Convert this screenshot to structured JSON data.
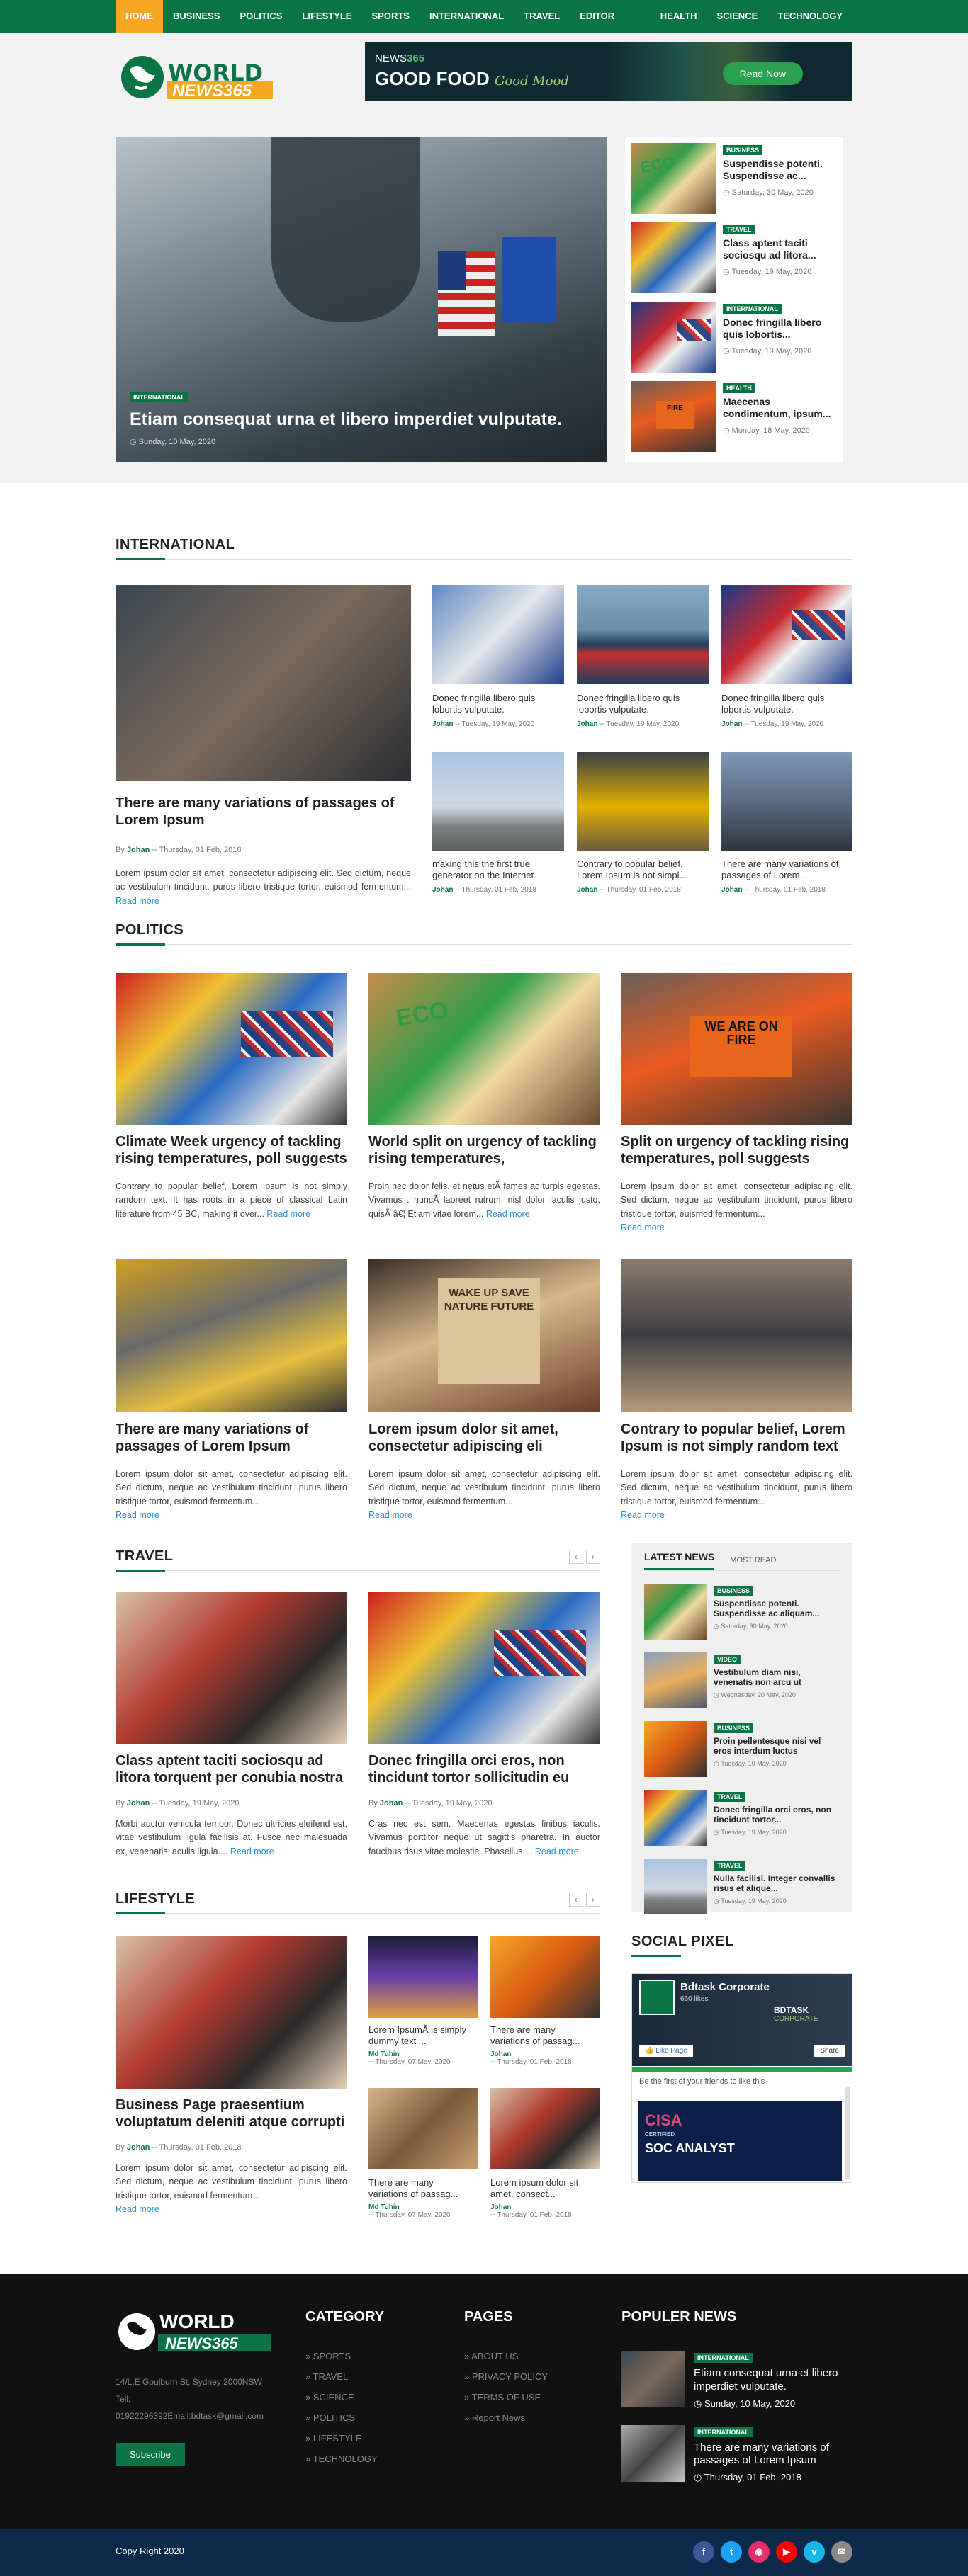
{
  "nav": [
    "HOME",
    "BUSINESS",
    "POLITICS",
    "LIFESTYLE",
    "SPORTS",
    "INTERNATIONAL",
    "TRAVEL",
    "EDITOR CHOICE",
    "HEALTH",
    "SCIENCE",
    "TECHNOLOGY"
  ],
  "logo": {
    "line1": "WORLD",
    "line2": "NEWS365"
  },
  "ad": {
    "brand_a": "NEWS",
    "brand_b": "365",
    "title": "GOOD FOOD",
    "script": "Good Mood",
    "button": "Read Now"
  },
  "hero": {
    "tag": "INTERNATIONAL",
    "title": "Etiam consequat urna et libero imperdiet vulputate.",
    "date": "Sunday, 10 May, 2020"
  },
  "side": [
    {
      "tag": "BUSINESS",
      "title": "Suspendisse potenti. Suspendisse ac...",
      "date": "Saturday, 30 May, 2020"
    },
    {
      "tag": "TRAVEL",
      "title": "Class aptent taciti sociosqu ad litora...",
      "date": "Tuesday, 19 May, 2020"
    },
    {
      "tag": "INTERNATIONAL",
      "title": "Donec fringilla libero quis lobortis...",
      "date": "Tuesday, 19 May, 2020"
    },
    {
      "tag": "HEALTH",
      "title": "Maecenas condimentum, ipsum...",
      "date": "Monday, 18 May, 2020"
    }
  ],
  "international": {
    "title": "INTERNATIONAL",
    "main": {
      "title": "There are many variations of passages of Lorem Ipsum",
      "by": "By",
      "author": "Johan",
      "date": "-- Thursday, 01 Feb, 2018",
      "excerpt": "Lorem ipsum dolor sit amet, consectetur adipiscing elit. Sed dictum, neque ac vestibulum tincidunt, purus libero tristique tortor, euismod fermentum...",
      "more": "Read more"
    },
    "grid": [
      {
        "title": "Donec fringilla libero quis lobortis vulputate.",
        "author": "Johan",
        "date": "-- Tuesday, 19 May, 2020"
      },
      {
        "title": "Donec fringilla libero quis lobortis vulputate.",
        "author": "Johan",
        "date": "-- Tuesday, 19 May, 2020"
      },
      {
        "title": "Donec fringilla libero quis lobortis vulputate.",
        "author": "Johan",
        "date": "-- Tuesday, 19 May, 2020"
      },
      {
        "title": "making this the first true generator on the Internet.",
        "author": "Johan",
        "date": "-- Thursday, 01 Feb, 2018"
      },
      {
        "title": "Contrary to popular belief, Lorem Ipsum is not simpl...",
        "author": "Johan",
        "date": "-- Thursday, 01 Feb, 2018"
      },
      {
        "title": "There are many variations of passages of Lorem...",
        "author": "Johan",
        "date": "-- Thursday, 01 Feb, 2018"
      }
    ]
  },
  "politics": {
    "title": "POLITICS",
    "items": [
      {
        "title": "Climate Week urgency of tackling rising temperatures, poll suggests",
        "excerpt": "Contrary to popular belief, Lorem Ipsum is not simply random text. It has roots in a piece of classical Latin literature from 45 BC, making it over...",
        "more": "Read more"
      },
      {
        "title": "World split on urgency of tackling rising temperatures,",
        "excerpt": "Proin nec dolor felis. et netus etÃ  fames ac turpis egestas. Vivamus . nuncÃ  laoreet rutrum, nisl dolor iaculis justo, quisÃ â€¦ Etiam vitae lorem...",
        "more": "Read more"
      },
      {
        "title": "Split on urgency of tackling rising temperatures, poll suggests",
        "excerpt": "Lorem ipsum dolor sit amet, consectetur adipiscing elit. Sed dictum, neque ac vestibulum tincidunt, purus libero tristique tortor, euismod fermentum...",
        "more": "Read more"
      },
      {
        "title": "There are many variations of passages of Lorem Ipsum",
        "excerpt": "Lorem ipsum dolor sit amet, consectetur adipiscing elit. Sed dictum, neque ac vestibulum tincidunt, purus libero tristique tortor, euismod fermentum...",
        "more": "Read more"
      },
      {
        "title": "Lorem ipsum dolor sit amet, consectetur adipiscing eli",
        "excerpt": "Lorem ipsum dolor sit amet, consectetur adipiscing elit. Sed dictum, neque ac vestibulum tincidunt, purus libero tristique tortor, euismod fermentum...",
        "more": "Read more"
      },
      {
        "title": "Contrary to popular belief, Lorem Ipsum is not simply random text",
        "excerpt": "Lorem ipsum dolor sit amet, consectetur adipiscing elit. Sed dictum, neque ac vestibulum tincidunt, purus libero tristique tortor, euismod fermentum...",
        "more": "Read more"
      }
    ],
    "signs": {
      "eco": "ECO",
      "fire": "WE ARE ON FIRE",
      "wake": "WAKE UP SAVE NATURE FUTURE"
    }
  },
  "travel": {
    "title": "TRAVEL",
    "items": [
      {
        "title": "Class aptent taciti sociosqu ad litora torquent per conubia nostra",
        "by": "By",
        "author": "Johan",
        "date": "-- Tuesday, 19 May, 2020",
        "excerpt": "Morbi auctor vehicula tempor. Donec ultricies eleifend est, vitae vestibulum ligula facilisis at. Fusce nec malesuada ex, venenatis iaculis ligula....",
        "more": "Read more"
      },
      {
        "title": "Donec fringilla orci eros, non tincidunt tortor sollicitudin eu",
        "by": "By",
        "author": "Johan",
        "date": "-- Tuesday, 19 May, 2020",
        "excerpt": "Cras nec est sem. Maecenas egestas finibus iaculis. Vivamus porttitor neque ut sagittis pharetra. In auctor faucibus risus vitae molestie. Phasellus....",
        "more": "Read more"
      }
    ]
  },
  "lifestyle": {
    "title": "LIFESTYLE",
    "main": {
      "title": "Business Page praesentium voluptatum deleniti atque corrupti",
      "by": "By",
      "author": "Johan",
      "date": "-- Thursday, 01 Feb, 2018",
      "excerpt": "Lorem ipsum dolor sit amet, consectetur adipiscing elit. Sed dictum, neque ac vestibulum tincidunt, purus libero tristique tortor, euismod fermentum...",
      "more": "Read more"
    },
    "grid": [
      {
        "title": "Lorem IpsumÃ is simply dummy text ...",
        "author": "Md Tuhin",
        "date": "-- Thursday, 07 May, 2020"
      },
      {
        "title": "There are many variations of passag...",
        "author": "Johan",
        "date": "-- Thursday, 01 Feb, 2018"
      },
      {
        "title": "There are many variations of passag...",
        "author": "Md Tuhin",
        "date": "-- Thursday, 07 May, 2020"
      },
      {
        "title": "Lorem ipsum dolor sit amet, consect...",
        "author": "Johan",
        "date": "-- Thursday, 01 Feb, 2018"
      }
    ]
  },
  "tabs": {
    "active": "LATEST NEWS",
    "other": "MOST READ",
    "items": [
      {
        "tag": "BUSINESS",
        "title": "Suspendisse potenti. Suspendisse ac aliquam...",
        "date": "Saturday, 30 May, 2020"
      },
      {
        "tag": "VIDEO",
        "title": "Vestibulum diam nisi, venenatis non arcu ut",
        "date": "Wednesday, 20 May, 2020"
      },
      {
        "tag": "BUSINESS",
        "title": "Proin pellentesque nisi vel eros interdum luctus",
        "date": "Tuesday, 19 May, 2020"
      },
      {
        "tag": "TRAVEL",
        "title": "Donec fringilla orci eros, non tincidunt tortor...",
        "date": "Tuesday, 19 May, 2020"
      },
      {
        "tag": "TRAVEL",
        "title": "Nulla facilisi. Integer convallis risus et alique...",
        "date": "Tuesday, 19 May, 2020"
      }
    ]
  },
  "social": {
    "title": "SOCIAL PIXEL",
    "page": "Bdtask Corporate",
    "likes": "660 likes",
    "like_btn": "Like Page",
    "share": "Share",
    "friends": "Be the first of your friends to like this",
    "post1": "BDTASK",
    "post2": "CORPORATE",
    "cisa": "CISA",
    "soc": "SOC ANALYST",
    "badge": "CERTIFIED"
  },
  "footer": {
    "logo1": "WORLD",
    "logo2": "NEWS365",
    "address": "14/L,E Goulburn St, Sydney 2000NSW",
    "tel": "Tell:",
    "contact": "01922296392Email:bdtask@gmail.com",
    "subscribe": "Subscribe",
    "cat_title": "CATEGORY",
    "categories": [
      "SPORTS",
      "TRAVEL",
      "SCIENCE",
      "POLITICS",
      "LIFESTYLE",
      "TECHNOLOGY"
    ],
    "pages_title": "PAGES",
    "pages": [
      "ABOUT US",
      "PRIVACY POLICY",
      "TERMS OF USE",
      "Report News"
    ],
    "pop_title": "POPULER NEWS",
    "popular": [
      {
        "tag": "INTERNATIONAL",
        "title": "Etiam consequat urna et libero imperdiet vulputate.",
        "date": "Sunday, 10 May, 2020"
      },
      {
        "tag": "INTERNATIONAL",
        "title": "There are many variations of passages of Lorem Ipsum",
        "date": "Thursday, 01 Feb, 2018"
      }
    ],
    "copyright": "Copy Right 2020"
  },
  "colors": {
    "brand": "#0a7447",
    "accent": "#f5a623",
    "link": "#2e90d1"
  }
}
